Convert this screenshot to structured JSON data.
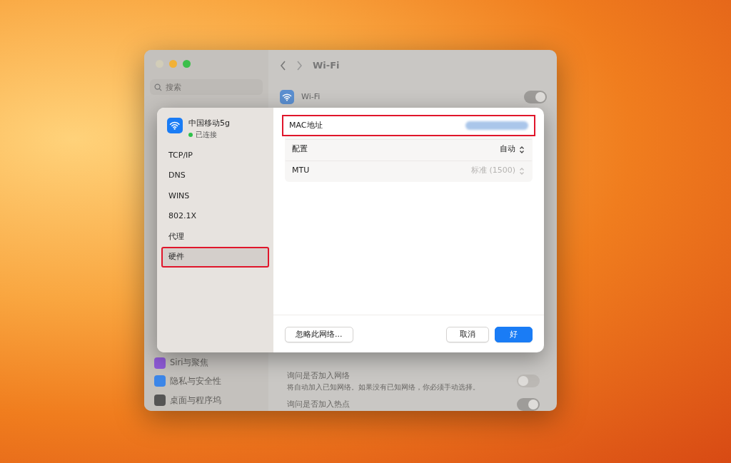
{
  "window": {
    "title": "Wi-Fi",
    "search": {
      "placeholder": "搜索"
    },
    "sidebar_items": [
      {
        "label": "Siri与聚焦",
        "color": "#8e5ad6"
      },
      {
        "label": "隐私与安全性",
        "color": "#3c86e8"
      },
      {
        "label": "桌面与程序坞",
        "color": "#555555"
      }
    ],
    "wifi_row": {
      "label": "Wi-Fi",
      "on": true
    },
    "settings": [
      {
        "label": "询问是否加入网络",
        "description": "将自动加入已知网络。如果没有已知网络，你必须手动选择。",
        "on": false
      },
      {
        "label": "询问是否加入热点",
        "on": true
      }
    ]
  },
  "dialog": {
    "network": {
      "name": "中国移动5g",
      "status": "已连接",
      "connected": true
    },
    "menu": [
      {
        "label": "TCP/IP",
        "selected": false,
        "annotated": false
      },
      {
        "label": "DNS",
        "selected": false,
        "annotated": false
      },
      {
        "label": "WINS",
        "selected": false,
        "annotated": false
      },
      {
        "label": "802.1X",
        "selected": false,
        "annotated": false
      },
      {
        "label": "代理",
        "selected": false,
        "annotated": false
      },
      {
        "label": "硬件",
        "selected": true,
        "annotated": true
      }
    ],
    "rows": [
      {
        "kind": "blurred",
        "label": "MAC地址",
        "annotated": true
      },
      {
        "kind": "select",
        "label": "配置",
        "value": "自动",
        "disabled": false,
        "annotated": false
      },
      {
        "kind": "select",
        "label": "MTU",
        "value": "标准 (1500)",
        "disabled": true,
        "annotated": false
      }
    ],
    "buttons": [
      {
        "label": "忽略此网络...",
        "primary": false
      },
      {
        "label": "取消",
        "primary": false
      },
      {
        "label": "好",
        "primary": true
      }
    ]
  }
}
